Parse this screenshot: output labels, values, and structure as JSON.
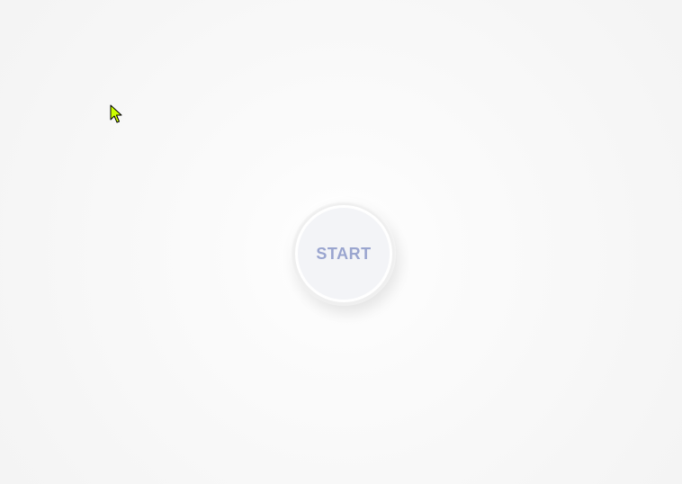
{
  "start_button": {
    "label": "START"
  },
  "cursor": {
    "icon": "arrow-pointer-icon",
    "fill_color": "#ccff00",
    "outline_color": "#000000"
  },
  "colors": {
    "background": "#f5f5f5",
    "button_face": "#f3f4f7",
    "label": "#9aa5cf"
  }
}
